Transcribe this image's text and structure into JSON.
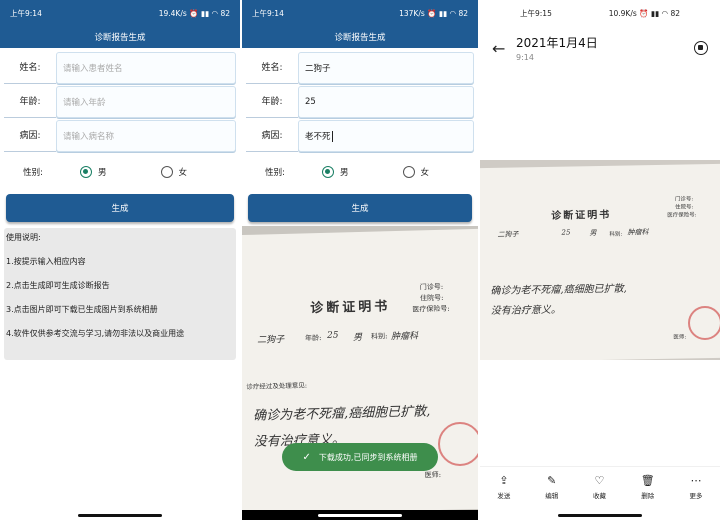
{
  "colors": {
    "primary": "#1f5b93",
    "toast": "#3e8e4c",
    "radio_checked": "#1a7f64"
  },
  "phone1": {
    "status": {
      "time": "上午9:14",
      "speed": "19.4K/s",
      "battery": "82"
    },
    "title": "诊断报告生成",
    "fields": [
      {
        "label": "姓名:",
        "placeholder": "请输入患者姓名"
      },
      {
        "label": "年龄:",
        "placeholder": "请输入年龄"
      },
      {
        "label": "病因:",
        "placeholder": "请输入病名称"
      }
    ],
    "gender": {
      "label": "性别:",
      "male": "男",
      "female": "女",
      "selected": "男"
    },
    "generate_label": "生成",
    "instructions": {
      "heading": "使用说明:",
      "items": [
        "1.按提示输入相应内容",
        "2.点击生成即可生成诊断报告",
        "3.点击图片即可下载已生成图片到系统相册",
        "4.软件仅供参考交流与学习,请勿非法以及商业用途"
      ]
    }
  },
  "phone2": {
    "status": {
      "time": "上午9:14",
      "speed": "137K/s",
      "battery": "82"
    },
    "title": "诊断报告生成",
    "fields": [
      {
        "label": "姓名:",
        "value": "二狗子"
      },
      {
        "label": "年龄:",
        "value": "25"
      },
      {
        "label": "病因:",
        "value": "老不死"
      }
    ],
    "gender": {
      "label": "性别:",
      "male": "男",
      "female": "女",
      "selected": "男"
    },
    "generate_label": "生成",
    "certificate": {
      "title": "诊断证明书",
      "door_no": "门诊号:",
      "admission_no": "住院号:",
      "insurance_no": "医疗保险号:",
      "name_hw": "二狗子",
      "age_label": "年龄:",
      "age_hw": "25",
      "gender_hw": "男",
      "dept_label": "科别:",
      "dept_hw": "肿瘤科",
      "opinion_label": "诊疗经过及处理意见:",
      "diagnosis_line1": "确诊为老不死瘤,癌细胞已扩散,",
      "diagnosis_line2": "没有治疗意义。",
      "doctor_label": "医师:"
    },
    "toast": "下载成功,已同步到系统相册"
  },
  "phone3": {
    "status": {
      "time": "上午9:15",
      "speed": "10.9K/s",
      "battery": "82"
    },
    "date": "2021年1月4日",
    "time": "9:14",
    "certificate": {
      "title": "诊断证明书",
      "door_no": "门诊号:",
      "admission_no": "住院号:",
      "insurance_no": "医疗保险号:",
      "name_hw": "二狗子",
      "age_hw": "25",
      "gender_hw": "男",
      "dept_label": "科别:",
      "dept_hw": "肿瘤科",
      "diagnosis_line1": "确诊为老不死瘤,癌细胞已扩散,",
      "diagnosis_line2": "没有治疗意义。",
      "doctor_label": "医师:"
    },
    "actions": [
      {
        "label": "发送",
        "icon": "share-icon"
      },
      {
        "label": "编辑",
        "icon": "edit-icon"
      },
      {
        "label": "收藏",
        "icon": "heart-icon"
      },
      {
        "label": "删除",
        "icon": "trash-icon"
      },
      {
        "label": "更多",
        "icon": "more-icon"
      }
    ]
  }
}
